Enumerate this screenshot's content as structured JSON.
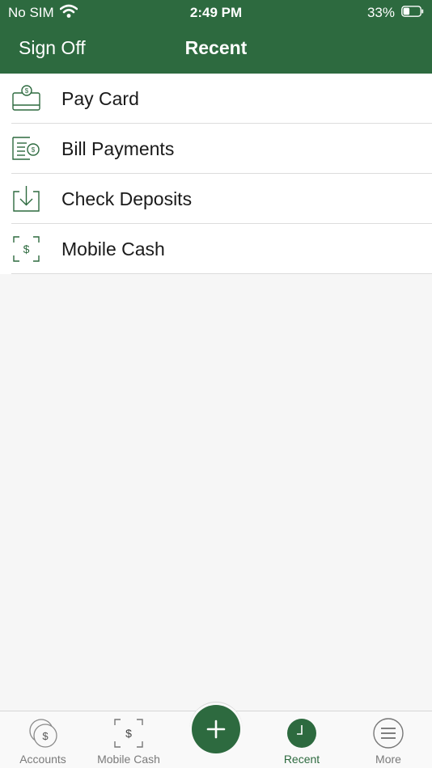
{
  "status": {
    "carrier": "No SIM",
    "time": "2:49 PM",
    "battery": "33%"
  },
  "nav": {
    "left_button": "Sign Off",
    "title": "Recent"
  },
  "list": [
    {
      "label": "Pay Card",
      "icon": "pay-card-icon"
    },
    {
      "label": "Bill Payments",
      "icon": "bill-payments-icon"
    },
    {
      "label": "Check Deposits",
      "icon": "check-deposits-icon"
    },
    {
      "label": "Mobile Cash",
      "icon": "mobile-cash-icon"
    }
  ],
  "tabs": [
    {
      "label": "Accounts",
      "icon": "accounts-icon",
      "active": false
    },
    {
      "label": "Mobile Cash",
      "icon": "mobile-cash-icon",
      "active": false
    },
    {
      "label": "",
      "icon": "plus-icon",
      "active": false
    },
    {
      "label": "Recent",
      "icon": "clock-icon",
      "active": true
    },
    {
      "label": "More",
      "icon": "menu-icon",
      "active": false
    }
  ],
  "colors": {
    "brand": "#2d6a3f",
    "background": "#f6f6f6",
    "inactive_tab": "#7a7a7a"
  }
}
